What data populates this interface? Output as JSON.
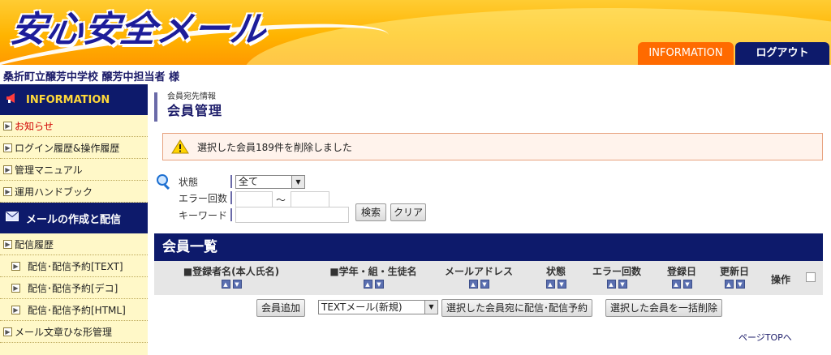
{
  "header": {
    "logo_text": "安心安全メール",
    "tabs": {
      "information": "INFORMATION",
      "logout": "ログアウト"
    }
  },
  "user": {
    "name": "桑折町立醸芳中学校 醸芳中担当者 様"
  },
  "sidebar": {
    "section1_title": "INFORMATION",
    "section1_items": [
      "お知らせ",
      "ログイン履歴&操作履歴",
      "管理マニュアル",
      "運用ハンドブック"
    ],
    "section2_title": "メールの作成と配信",
    "section2_items": [
      "配信履歴",
      "配信･配信予約[TEXT]",
      "配信･配信予約[デコ]",
      "配信･配信予約[HTML]",
      "メール文章ひな形管理"
    ]
  },
  "page": {
    "breadcrumb": "会員宛先情報",
    "title": "会員管理"
  },
  "alert": {
    "message": "選択した会員189件を削除しました"
  },
  "search": {
    "status_label": "状態",
    "status_value": "全て",
    "error_label": "エラー回数",
    "range_sep": "～",
    "keyword_label": "キーワード",
    "search_button": "検索",
    "clear_button": "クリア"
  },
  "list": {
    "title": "会員一覧",
    "columns": [
      "■登録者名(本人氏名)",
      "■学年・組・生徒名",
      "メールアドレス",
      "状態",
      "エラー回数",
      "登録日",
      "更新日",
      "操作"
    ]
  },
  "actions": {
    "add_member": "会員追加",
    "mail_type": "TEXTメール(新規)",
    "send_selected": "選択した会員宛に配信･配信予約",
    "delete_selected": "選択した会員を一括削除"
  },
  "footer": {
    "page_top": "ページTOPへ"
  },
  "colors": {
    "navy": "#0d1a6b",
    "orange": "#ff6a00",
    "sidebar_bg": "#fff8c8",
    "alert_red": "#d10000"
  }
}
